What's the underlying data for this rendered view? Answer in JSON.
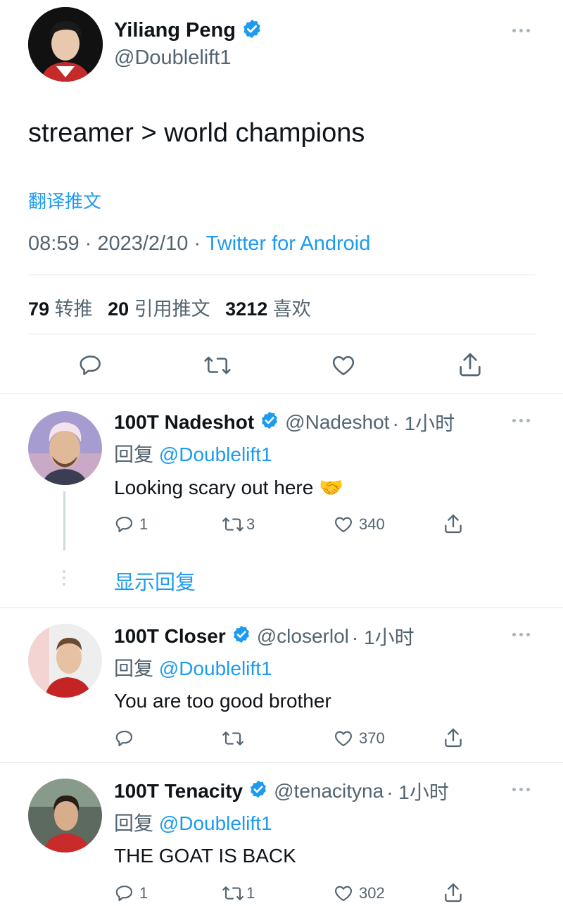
{
  "tweet": {
    "author_name": "Yiliang Peng",
    "author_handle": "@Doublelift1",
    "text": "streamer > world champions",
    "translate": "翻译推文",
    "time": "08:59",
    "date": "2023/2/10",
    "source": "Twitter for Android",
    "retweets_count": "79",
    "retweets_label": "转推",
    "quotes_count": "20",
    "quotes_label": "引用推文",
    "likes_count": "3212",
    "likes_label": "喜欢"
  },
  "replies": [
    {
      "name": "100T Nadeshot",
      "handle": "@Nadeshot",
      "time": "· 1小时",
      "reply_prefix": "回复",
      "reply_to": "@Doublelift1",
      "text": "Looking scary out here 🤝",
      "reply_count": "1",
      "retweet_count": "3",
      "like_count": "340",
      "show_replies": "显示回复"
    },
    {
      "name": "100T Closer",
      "handle": "@closerlol",
      "time": "· 1小时",
      "reply_prefix": "回复",
      "reply_to": "@Doublelift1",
      "text": "You are too good brother",
      "reply_count": "",
      "retweet_count": "",
      "like_count": "370"
    },
    {
      "name": "100T Tenacity",
      "handle": "@tenacityna",
      "time": "· 1小时",
      "reply_prefix": "回复",
      "reply_to": "@Doublelift1",
      "text": "THE GOAT IS BACK",
      "reply_count": "1",
      "retweet_count": "1",
      "like_count": "302"
    }
  ],
  "colors": {
    "accent": "#1d9bf0",
    "text": "#0f1419",
    "muted": "#536471",
    "divider": "#e1e6ea"
  },
  "icons": [
    "verified-badge-icon",
    "more-dots-icon",
    "reply-icon",
    "retweet-icon",
    "like-icon",
    "share-icon",
    "handshake-emoji"
  ]
}
